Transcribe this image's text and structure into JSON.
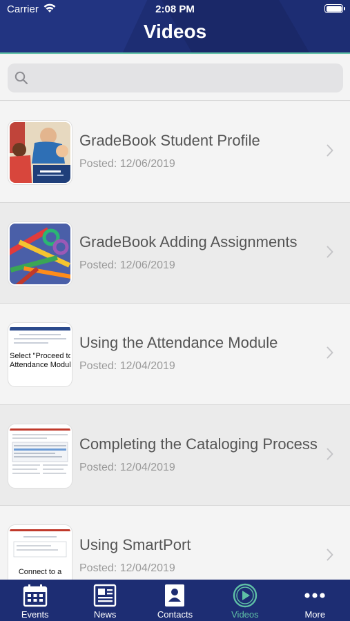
{
  "status": {
    "carrier": "Carrier",
    "time": "2:08 PM"
  },
  "header": {
    "title": "Videos"
  },
  "search": {
    "placeholder": ""
  },
  "videos": [
    {
      "title": "GradeBook Student Profile",
      "date": "Posted: 12/06/2019"
    },
    {
      "title": "GradeBook Adding Assignments",
      "date": "Posted: 12/06/2019"
    },
    {
      "title": "Using the Attendance Module",
      "date": "Posted: 12/04/2019",
      "thumb_text": [
        "Select \"Proceed to",
        "Attendance Modul"
      ]
    },
    {
      "title": "Completing the Cataloging Process",
      "date": "Posted: 12/04/2019"
    },
    {
      "title": "Using SmartPort",
      "date": "Posted: 12/04/2019",
      "thumb_text": [
        "Connect to a"
      ]
    }
  ],
  "tabs": [
    {
      "label": "Events",
      "icon": "calendar-icon"
    },
    {
      "label": "News",
      "icon": "newspaper-icon"
    },
    {
      "label": "Contacts",
      "icon": "contact-card-icon"
    },
    {
      "label": "Videos",
      "icon": "play-circle-icon",
      "active": true
    },
    {
      "label": "More",
      "icon": "more-dots-icon"
    }
  ],
  "colors": {
    "header": "#1d2d73",
    "accent": "#5fc0a6",
    "tabbar": "#1d2d73"
  }
}
